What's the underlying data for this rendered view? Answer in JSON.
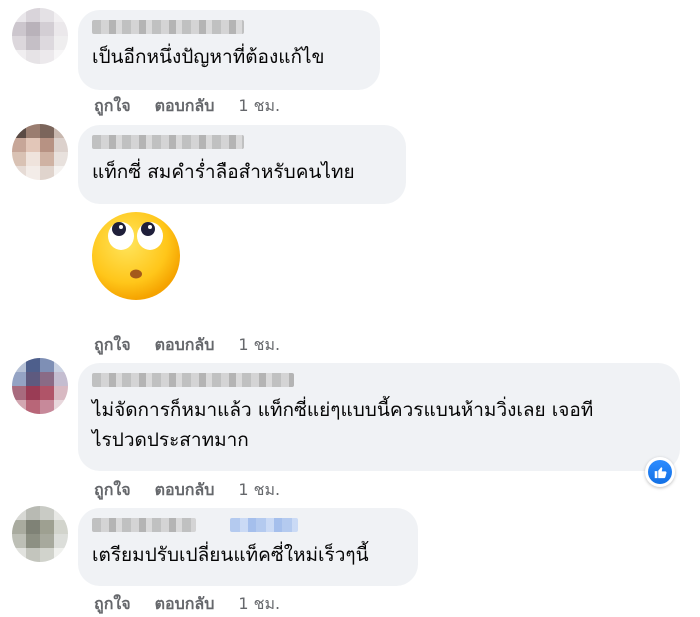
{
  "comments": [
    {
      "text": "เป็นอีกหนึ่งปัญหาที่ต้องแก้ไข",
      "like": "ถูกใจ",
      "reply": "ตอบกลับ",
      "time": "1 ชม."
    },
    {
      "text": "แท็กซี่ สมคำร่ำลือสำหรับคนไทย",
      "sticker": "eyes-rolling-emoji",
      "like": "ถูกใจ",
      "reply": "ตอบกลับ",
      "time": "1 ชม."
    },
    {
      "text": "ไม่จัดการก็หมาแล้ว แท็กซี่แย่ๆแบบนี้ควรแบนห้ามวิ่งเลย เจอที\nไรปวดประสาทมาก",
      "like": "ถูกใจ",
      "reply": "ตอบกลับ",
      "time": "1 ชม.",
      "reaction": "like-icon"
    },
    {
      "text": "เตรียมปรับเปลี่ยนแท็คซี่ใหม่เร็วๆนี้",
      "like": "ถูกใจ",
      "reply": "ตอบกลับ",
      "time": "1 ชม."
    }
  ],
  "colors": {
    "bubble": "#f0f2f5",
    "action_text": "#65676b",
    "like_blue": "#1877f2"
  }
}
